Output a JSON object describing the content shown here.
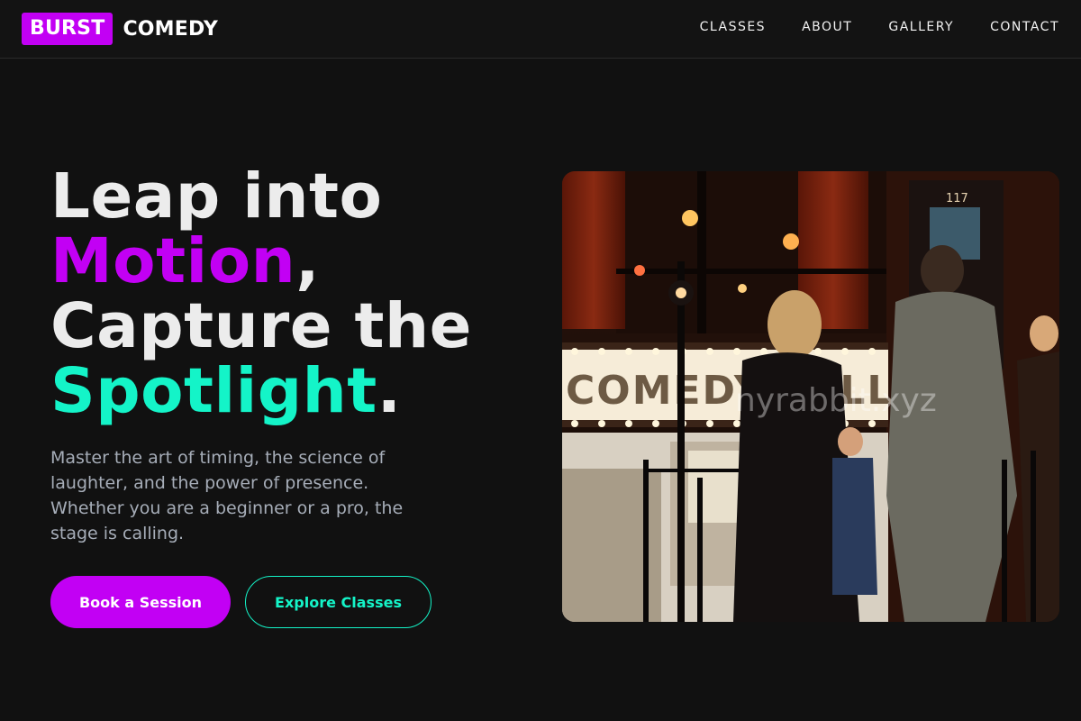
{
  "header": {
    "logo_box": "BURST",
    "logo_text": "COMEDY",
    "nav": [
      "CLASSES",
      "ABOUT",
      "GALLERY",
      "CONTACT"
    ]
  },
  "hero": {
    "headline": {
      "line1": "Leap into",
      "line2_accent": "Motion",
      "line2_rest": ",",
      "line3": "Capture the",
      "line4_accent": "Spotlight",
      "line4_rest": "."
    },
    "subtext": "Master the art of timing, the science of laughter, and the power of presence. Whether you are a beginner or a pro, the stage is calling.",
    "primary_button": "Book a Session",
    "secondary_button": "Explore Classes"
  },
  "photo": {
    "marquee_text": "COMEDY CELLAR",
    "door_number": "117",
    "watermark": "nyrabbit.xyz"
  },
  "colors": {
    "background": "#111111",
    "brand_purple": "#c200f4",
    "brand_teal": "#14f4c8",
    "body_text": "#a6adb8"
  }
}
